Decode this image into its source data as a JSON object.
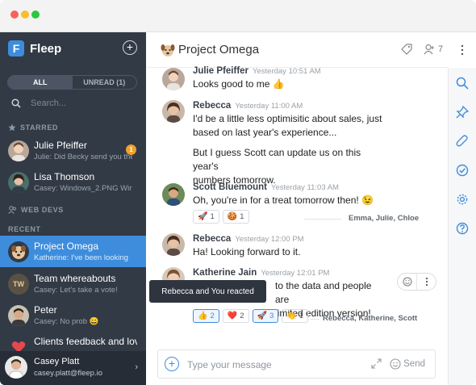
{
  "app": {
    "name": "Fleep",
    "logo_letter": "F"
  },
  "colors": {
    "accent": "#3e8ddd",
    "sidebar": "#323a45",
    "badge": "#f0a22b"
  },
  "sidebar": {
    "filter": {
      "all": "ALL",
      "unread": "UNREAD (1)"
    },
    "search_placeholder": "Search...",
    "sections": {
      "starred": "STARRED",
      "web_devs": "WEB DEVS",
      "recent": "RECENT"
    },
    "starred": [
      {
        "name": "Julie Pfeiffer",
        "sub": "Julie: Did Becky send you the",
        "badge": "1"
      },
      {
        "name": "Lisa Thomson",
        "sub": "Casey: Windows_2.PNG Wind"
      }
    ],
    "recent": [
      {
        "name": "Project Omega",
        "sub": "Katherine: I've been looking"
      },
      {
        "name": "Team whereabouts",
        "sub": "Casey: Let's take a vote!",
        "initials": "TW"
      },
      {
        "name": "Peter",
        "sub": "Casey: No prob 😄"
      },
      {
        "name": "Clients feedback and lov",
        "sub": ""
      }
    ],
    "user": {
      "name": "Casey Platt",
      "email": "casey.platt@fleep.io"
    }
  },
  "chat": {
    "title": "Project Omega",
    "member_count": "7",
    "messages": [
      {
        "author": "Julie Pfeiffer",
        "time": "Yesterday 10:51 AM",
        "text": "Looks good to me 👍"
      },
      {
        "author": "Rebecca",
        "time": "Yesterday 11:00 AM",
        "lines": [
          "I'd be a little less optimisitic about sales, just",
          "based on last year's experience..."
        ],
        "lines2": [
          "But I guess Scott can update us on this year's",
          "numbers tomorrow."
        ]
      },
      {
        "author": "Scott Bluemount",
        "time": "Yesterday 11:03 AM",
        "text": "Oh, you're in for a treat tomorrow then! 😉",
        "reactions": [
          {
            "emoji": "🚀",
            "count": "1"
          },
          {
            "emoji": "🍪",
            "count": "1"
          }
        ],
        "seen": "Emma, Julie, Chloe"
      },
      {
        "author": "Rebecca",
        "time": "Yesterday 12:00 PM",
        "text": "Ha! Looking forward to it."
      },
      {
        "author": "Katherine Jain",
        "time": "Yesterday 12:01 PM",
        "lines": [
          "to the data and people are",
          "limited edition version!"
        ],
        "reactions": [
          {
            "emoji": "👍",
            "count": "2"
          },
          {
            "emoji": "❤️",
            "count": "2"
          },
          {
            "emoji": "🚀",
            "count": "3"
          },
          {
            "emoji": "👏",
            "count": "1"
          }
        ],
        "seen": "Rebecca, Katherine, Scott"
      }
    ],
    "tooltip": "Rebecca and You reacted",
    "composer": {
      "placeholder": "Type your message",
      "send": "Send"
    }
  },
  "icons": [
    "search-icon",
    "pin-icon",
    "paperclip-icon",
    "check-circle-icon",
    "gear-icon",
    "help-icon",
    "tag-icon",
    "members-icon",
    "more-icon"
  ]
}
